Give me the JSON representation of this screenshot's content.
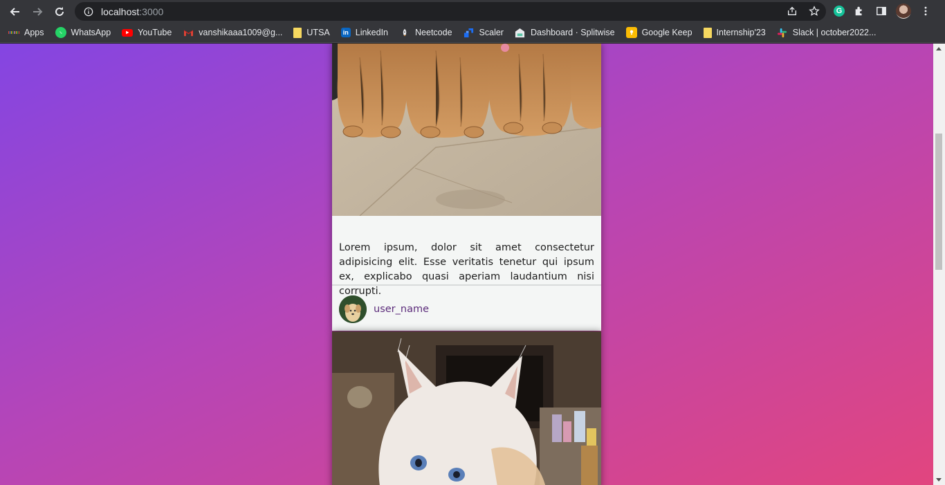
{
  "browser": {
    "url_host": "localhost",
    "url_port": ":3000",
    "icons": [
      "back-icon",
      "forward-icon",
      "reload-icon",
      "site-info-icon",
      "share-icon",
      "bookmark-star-icon",
      "grammarly-icon",
      "extensions-icon",
      "side-panel-icon",
      "profile-avatar",
      "menu-icon"
    ],
    "grammarly_letter": "G"
  },
  "bookmarks": [
    {
      "label": "Apps",
      "icon": "apps-grid-icon"
    },
    {
      "label": "WhatsApp",
      "icon": "whatsapp-icon",
      "color": "#25d366"
    },
    {
      "label": "YouTube",
      "icon": "youtube-icon",
      "color": "#ff0000"
    },
    {
      "label": "vanshikaaa1009@g...",
      "icon": "gmail-icon",
      "color": "#ea4335"
    },
    {
      "label": "UTSA",
      "icon": "note-icon",
      "color": "#f6d860"
    },
    {
      "label": "LinkedIn",
      "icon": "linkedin-icon",
      "color": "#0a66c2"
    },
    {
      "label": "Neetcode",
      "icon": "neetcode-icon"
    },
    {
      "label": "Scaler",
      "icon": "scaler-icon",
      "color": "#1c6df2"
    },
    {
      "label": "Dashboard · Splitwise",
      "icon": "splitwise-icon"
    },
    {
      "label": "Google Keep",
      "icon": "keep-icon",
      "color": "#fbbc04"
    },
    {
      "label": "Internship'23",
      "icon": "note-icon",
      "color": "#f6d860"
    },
    {
      "label": "Slack | october2022...",
      "icon": "slack-icon"
    }
  ],
  "feed": {
    "posts": [
      {
        "image": "golden-retriever-puppies-photo",
        "caption": "Lorem ipsum, dolor sit amet consectetur adipisicing elit. Esse veritatis tenetur qui ipsum ex, explicabo quasi aperiam laudantium nisi corrupti.",
        "author": "user_name"
      },
      {
        "image": "white-kitten-photo"
      }
    ]
  },
  "colors": {
    "gradient_start": "#8445e2",
    "gradient_end": "#e2457e",
    "username": "#5b2b7a"
  }
}
